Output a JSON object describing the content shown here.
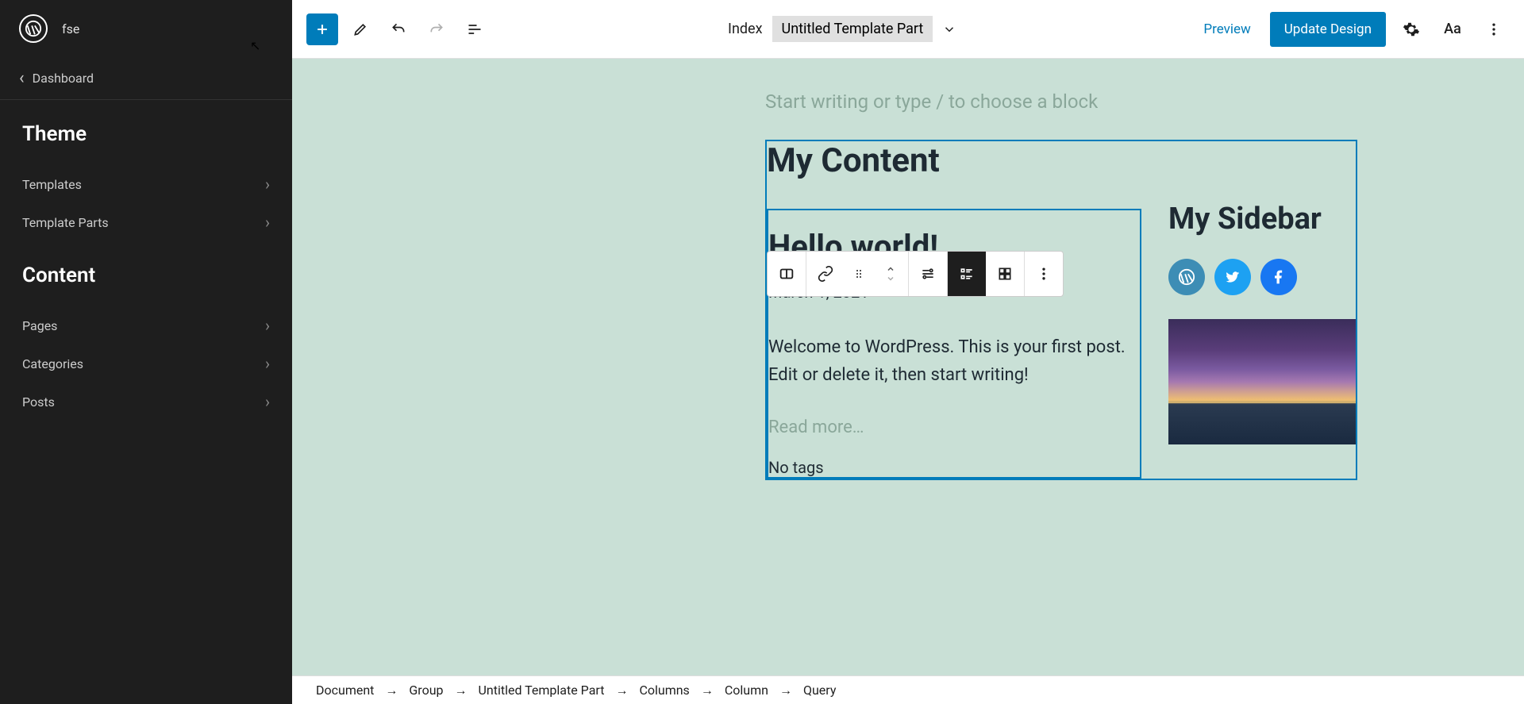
{
  "sidebar": {
    "site_title": "fse",
    "back_label": "Dashboard",
    "sections": [
      {
        "title": "Theme",
        "items": [
          {
            "label": "Templates"
          },
          {
            "label": "Template Parts"
          }
        ]
      },
      {
        "title": "Content",
        "items": [
          {
            "label": "Pages"
          },
          {
            "label": "Categories"
          },
          {
            "label": "Posts"
          }
        ]
      }
    ]
  },
  "topbar": {
    "doc_label": "Index",
    "template_part": "Untitled Template Part",
    "preview": "Preview",
    "update": "Update Design"
  },
  "canvas": {
    "placeholder": "Start writing or type / to choose a block",
    "main_heading": "My Content",
    "post": {
      "title": "Hello world!",
      "date": "March 1, 2021",
      "body": "Welcome to WordPress. This is your first post. Edit or delete it, then start writing!",
      "read_more": "Read more…",
      "no_tags": "No tags"
    },
    "sidebar_widget": {
      "title": "My Sidebar"
    }
  },
  "breadcrumb": [
    "Document",
    "Group",
    "Untitled Template Part",
    "Columns",
    "Column",
    "Query"
  ],
  "colors": {
    "accent": "#007cba",
    "canvas_bg": "#c9e0d6"
  }
}
